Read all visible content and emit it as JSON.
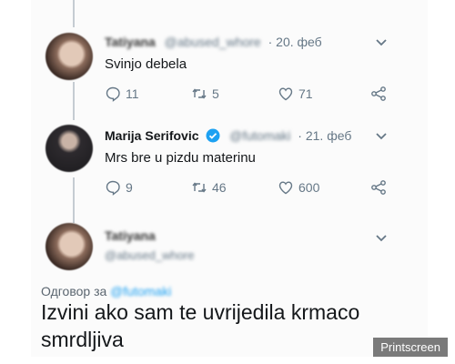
{
  "tweets": [
    {
      "name": "Tatiyana",
      "handle": "@abused_whore",
      "date": "· 20. феб",
      "text": "Svinjo debela",
      "replies": "11",
      "retweets": "5",
      "likes": "71"
    },
    {
      "name": "Marija Serifovic",
      "handle": "@futomaki",
      "date": "· 21. феб",
      "text": "Mrs bre u pizdu materinu",
      "replies": "9",
      "retweets": "46",
      "likes": "600",
      "verified": true
    }
  ],
  "reply_tweet": {
    "name": "Tatiyana",
    "handle": "@abused_whore",
    "reply_prefix": "Одговор за",
    "reply_handle": "@futomaki",
    "text": "Izvini ako sam te uvrijedila krmaco smrdljiva"
  },
  "watermark": "Printscreen",
  "colors": {
    "text": "#14171a",
    "muted": "#657786",
    "accent": "#1da1f2"
  },
  "icons": [
    "reply-icon",
    "retweet-icon",
    "like-icon",
    "share-icon",
    "chevron-down-icon",
    "verified-badge-icon"
  ]
}
